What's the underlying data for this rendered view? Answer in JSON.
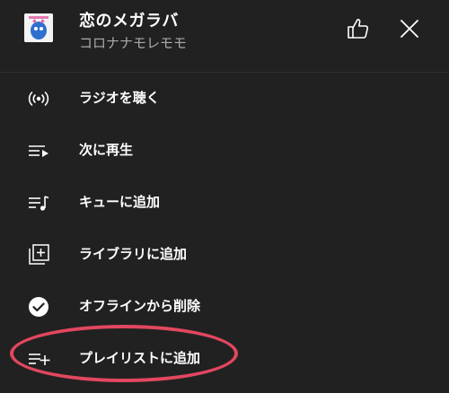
{
  "song": {
    "title": "恋のメガラバ",
    "artist": "コロナナモレモモ"
  },
  "header": {
    "like_icon": "thumbs-up-icon",
    "close_icon": "close-icon"
  },
  "menu": {
    "items": [
      {
        "label": "ラジオを聴く",
        "icon": "radio-icon"
      },
      {
        "label": "次に再生",
        "icon": "play-next-icon"
      },
      {
        "label": "キューに追加",
        "icon": "queue-music-icon"
      },
      {
        "label": "ライブラリに追加",
        "icon": "library-add-icon"
      },
      {
        "label": "オフラインから削除",
        "icon": "downloaded-check-icon"
      },
      {
        "label": "プレイリストに追加",
        "icon": "playlist-add-icon"
      }
    ]
  },
  "annotation": {
    "highlight_color": "#e2475f"
  }
}
